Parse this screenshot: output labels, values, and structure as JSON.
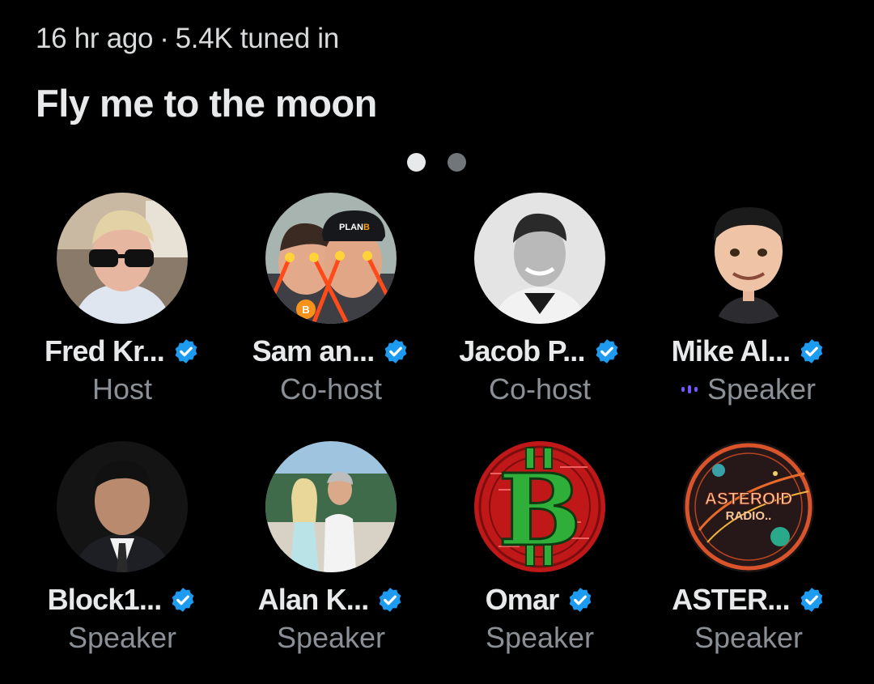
{
  "space": {
    "started": "16 hr ago",
    "separator": "·",
    "listeners": "5.4K tuned in",
    "title": "Fly me to the moon"
  },
  "pager": {
    "pages": 2,
    "current": 1
  },
  "participants": [
    {
      "name": "Fred Kr...",
      "role": "Host",
      "verified": true,
      "speaking": false,
      "avatar_icon": "person-photo-icon"
    },
    {
      "name": "Sam an...",
      "role": "Co-host",
      "verified": true,
      "speaking": false,
      "avatar_icon": "cartoon-laser-eyes-icon"
    },
    {
      "name": "Jacob P...",
      "role": "Co-host",
      "verified": true,
      "speaking": false,
      "avatar_icon": "person-photo-icon"
    },
    {
      "name": "Mike Al...",
      "role": "Speaker",
      "verified": true,
      "speaking": true,
      "avatar_icon": "caricature-icon"
    },
    {
      "name": "Block1...",
      "role": "Speaker",
      "verified": true,
      "speaking": false,
      "avatar_icon": "person-photo-icon"
    },
    {
      "name": "Alan K...",
      "role": "Speaker",
      "verified": true,
      "speaking": false,
      "avatar_icon": "couple-photo-icon"
    },
    {
      "name": "Omar",
      "role": "Speaker",
      "verified": true,
      "speaking": false,
      "avatar_icon": "bitcoin-logo-icon"
    },
    {
      "name": "ASTER...",
      "role": "Speaker",
      "verified": true,
      "speaking": false,
      "avatar_icon": "asteroid-radio-logo-icon",
      "avatar_text": [
        "ASTEROID",
        "RADIO.."
      ]
    }
  ],
  "decor": {
    "plan_b_cap": "PLAN",
    "cap_letter": "B",
    "coin_letter": "B"
  },
  "colors": {
    "verified": "#1d9bf0",
    "speaking": "#7856ff",
    "bitcoin_bg": "#c01818",
    "bitcoin_fg": "#2fae3a"
  }
}
